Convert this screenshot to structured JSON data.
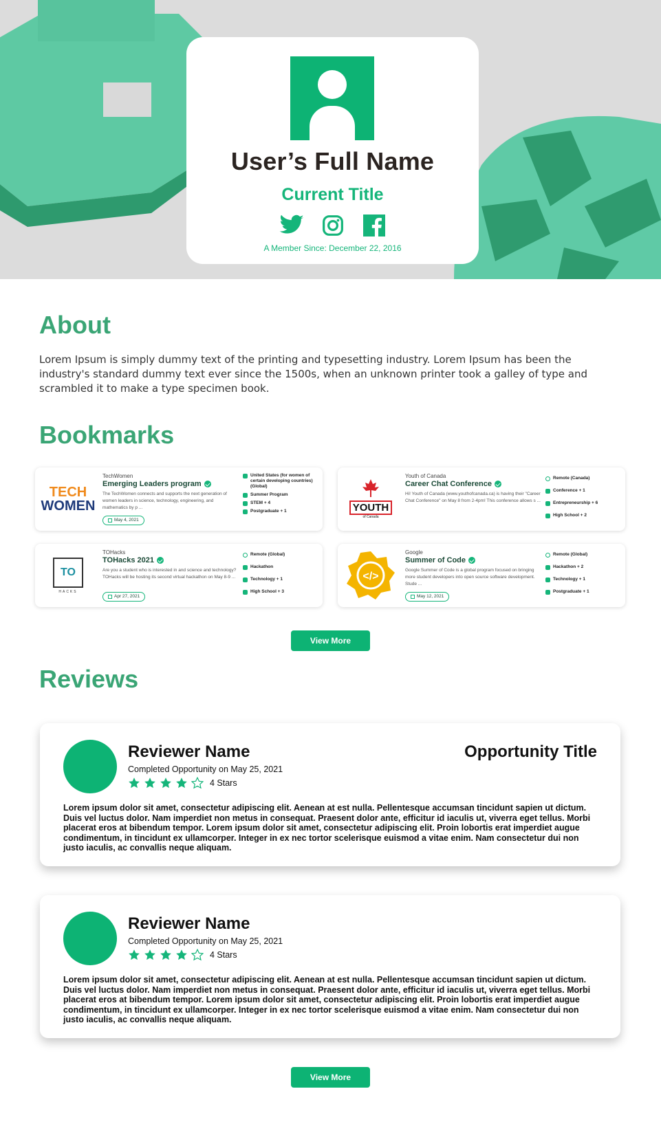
{
  "profile": {
    "name": "User’s Full Name",
    "title": "Current Title",
    "member_since": "A Member Since: December 22, 2016",
    "socials": [
      "twitter-icon",
      "instagram-icon",
      "facebook-icon"
    ]
  },
  "about": {
    "heading": "About",
    "text": "Lorem Ipsum is simply dummy text of the printing and typesetting industry. Lorem Ipsum has been the industry's standard dummy text ever since the 1500s, when an unknown printer took a galley of type and scrambled it to make a type specimen book."
  },
  "bookmarks": {
    "heading": "Bookmarks",
    "items": [
      {
        "org": "TechWomen",
        "title": "Emerging Leaders program",
        "desc": "The TechWomen connects and supports the next generation of women leaders in science, technology, engineering, and mathematics by p ...",
        "date": "May 4, 2021",
        "logo_line1": "TECH",
        "logo_line2": "WOMEN",
        "tags": [
          "United States (for women of certain developing countries) (Global)",
          "Summer Program",
          "STEM + 4",
          "Postgraduate + 1"
        ]
      },
      {
        "org": "Youth of Canada",
        "title": "Career Chat Conference",
        "desc": "Hi! Youth of Canada (www.youthofcanada.ca) is having their \"Career Chat Conference\" on May 8 from 2-4pm! This conference allows s ...",
        "date": "",
        "logo_line1": "YOUTH",
        "logo_line2": "of Canada",
        "tags": [
          "Remote (Canada)",
          "Conference + 1",
          "Entrepreneurship + 6",
          "High School + 2"
        ]
      },
      {
        "org": "TOHacks",
        "title": "TOHacks 2021",
        "desc": "Are you a student who is interested in and science and technology? TOHacks will be hosting its second virtual hackathon on May 8-9 ...",
        "date": "Apr 27, 2021",
        "logo_line1": "TO",
        "logo_line2": "HACKS",
        "tags": [
          "Remote (Global)",
          "Hackathon",
          "Technology + 1",
          "High School + 3"
        ]
      },
      {
        "org": "Google",
        "title": "Summer of Code",
        "desc": "Google Summer of Code is a global program focused on bringing more student developers into open source software development. Stude ...",
        "date": "May 12, 2021",
        "logo_line1": "</>",
        "logo_line2": "",
        "tags": [
          "Remote (Global)",
          "Hackathon + 2",
          "Technology + 1",
          "Postgraduate + 1"
        ]
      }
    ],
    "view_more": "View More"
  },
  "reviews": {
    "heading": "Reviews",
    "items": [
      {
        "name": "Reviewer Name",
        "opportunity": "Opportunity Title",
        "completed": "Completed Opportunity on May 25, 2021",
        "rating": 4,
        "rating_label": "4 Stars",
        "text": "Lorem ipsum dolor sit amet, consectetur adipiscing elit. Aenean at est nulla. Pellentesque accumsan tincidunt sapien ut dictum. Duis vel luctus dolor. Nam imperdiet non metus in consequat. Praesent dolor ante, efficitur id iaculis ut, viverra eget tellus. Morbi placerat eros at bibendum tempor. Lorem ipsum dolor sit amet, consectetur adipiscing elit. Proin lobortis erat imperdiet augue condimentum, in tincidunt ex ullamcorper. Integer in ex nec tortor scelerisque euismod a vitae enim. Nam consectetur dui non justo iaculis, ac convallis neque aliquam."
      },
      {
        "name": "Reviewer Name",
        "opportunity": "",
        "completed": "Completed Opportunity on May 25, 2021",
        "rating": 4,
        "rating_label": "4 Stars",
        "text": "Lorem ipsum dolor sit amet, consectetur adipiscing elit. Aenean at est nulla. Pellentesque accumsan tincidunt sapien ut dictum. Duis vel luctus dolor. Nam imperdiet non metus in consequat. Praesent dolor ante, efficitur id iaculis ut, viverra eget tellus. Morbi placerat eros at bibendum tempor. Lorem ipsum dolor sit amet, consectetur adipiscing elit. Proin lobortis erat imperdiet augue condimentum, in tincidunt ex ullamcorper. Integer in ex nec tortor scelerisque euismod a vitae enim. Nam consectetur dui non justo iaculis, ac convallis neque aliquam."
      }
    ],
    "view_more": "View More"
  },
  "colors": {
    "accent": "#0db374",
    "heading": "#3aa575",
    "hero_bg": "#dcdcdc"
  }
}
